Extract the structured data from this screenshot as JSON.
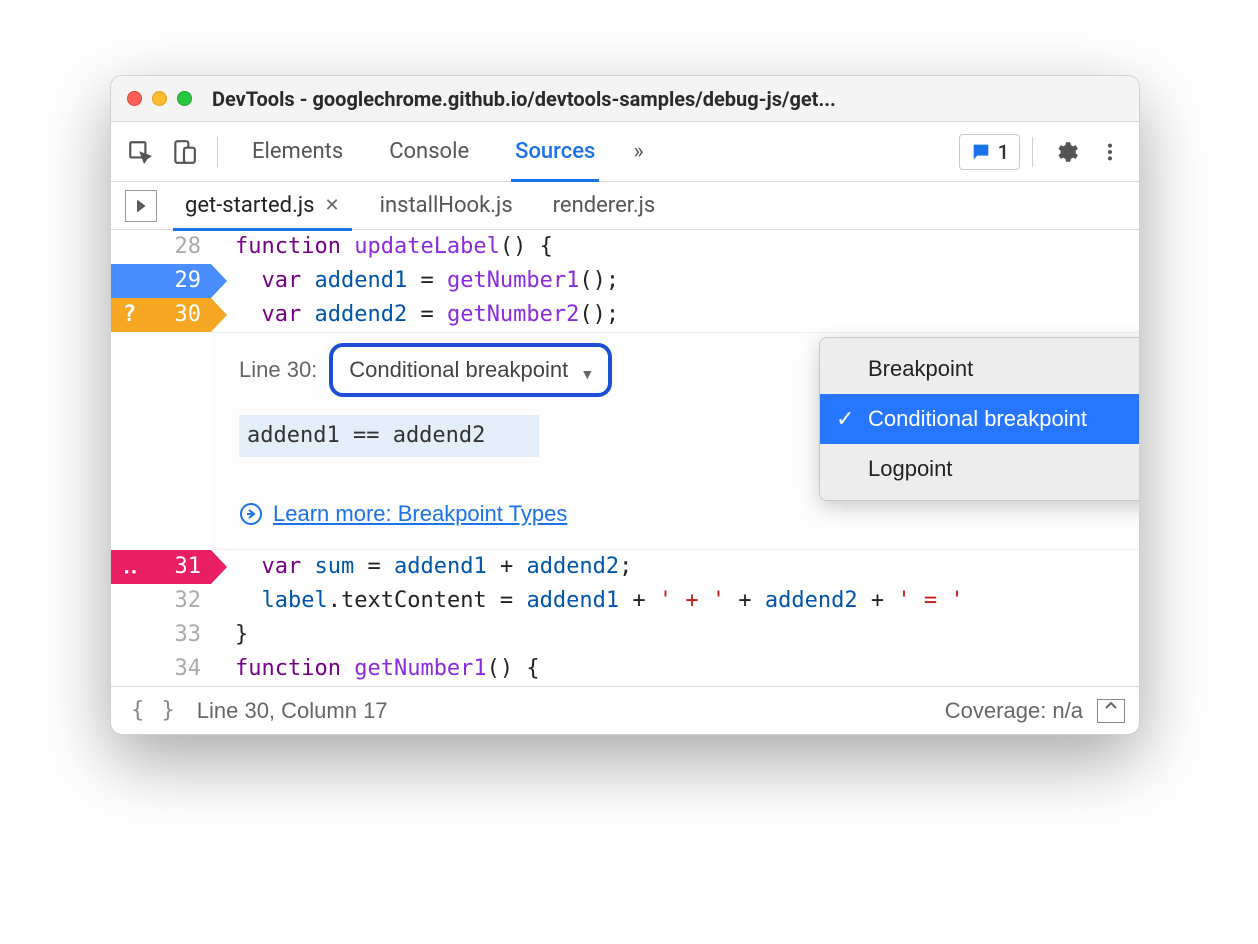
{
  "window": {
    "title": "DevTools - googlechrome.github.io/devtools-samples/debug-js/get..."
  },
  "toolbar": {
    "tabs": [
      "Elements",
      "Console",
      "Sources"
    ],
    "active_tab": "Sources",
    "overflow_glyph": "»",
    "messages_count": "1"
  },
  "file_tabs": {
    "items": [
      {
        "name": "get-started.js",
        "active": true
      },
      {
        "name": "installHook.js",
        "active": false
      },
      {
        "name": "renderer.js",
        "active": false
      }
    ]
  },
  "code": {
    "lines": [
      {
        "num": "28",
        "bp": null,
        "tokens": [
          [
            "kw",
            "function "
          ],
          [
            "fn",
            "updateLabel"
          ],
          [
            "pn",
            "() {"
          ]
        ]
      },
      {
        "num": "29",
        "bp": "blue",
        "tokens": [
          [
            "pn",
            "  "
          ],
          [
            "vk",
            "var "
          ],
          [
            "id",
            "addend1"
          ],
          [
            "op",
            " = "
          ],
          [
            "fn",
            "getNumber1"
          ],
          [
            "pn",
            "();"
          ]
        ]
      },
      {
        "num": "30",
        "bp": "orange",
        "bp_sym": "?",
        "tokens": [
          [
            "pn",
            "  "
          ],
          [
            "vk",
            "var "
          ],
          [
            "id",
            "addend2"
          ],
          [
            "op",
            " = "
          ],
          [
            "fn",
            "getNumber2"
          ],
          [
            "pn",
            "();"
          ]
        ]
      },
      {
        "num": "31",
        "bp": "pink",
        "bp_sym": "‥",
        "tokens": [
          [
            "pn",
            "  "
          ],
          [
            "vk",
            "var "
          ],
          [
            "id",
            "sum"
          ],
          [
            "op",
            " = "
          ],
          [
            "id",
            "addend1"
          ],
          [
            "op",
            " + "
          ],
          [
            "id",
            "addend2"
          ],
          [
            "pn",
            ";"
          ]
        ]
      },
      {
        "num": "32",
        "bp": null,
        "tokens": [
          [
            "pn",
            "  "
          ],
          [
            "id",
            "label"
          ],
          [
            "pn",
            "."
          ],
          [
            "prop",
            "textContent"
          ],
          [
            "op",
            " = "
          ],
          [
            "id",
            "addend1"
          ],
          [
            "op",
            " + "
          ],
          [
            "st",
            "' + '"
          ],
          [
            "op",
            " + "
          ],
          [
            "id",
            "addend2"
          ],
          [
            "op",
            " + "
          ],
          [
            "st",
            "' = '"
          ]
        ]
      },
      {
        "num": "33",
        "bp": null,
        "tokens": [
          [
            "pn",
            "}"
          ]
        ]
      },
      {
        "num": "34",
        "bp": null,
        "tokens": [
          [
            "kw",
            "function "
          ],
          [
            "fn",
            "getNumber1"
          ],
          [
            "pn",
            "() {"
          ]
        ]
      }
    ]
  },
  "breakpoint_editor": {
    "line_label": "Line 30:",
    "type_label": "Conditional breakpoint",
    "condition": "addend1 == addend2",
    "learn_more": "Learn more: Breakpoint Types",
    "dropdown": {
      "options": [
        "Breakpoint",
        "Conditional breakpoint",
        "Logpoint"
      ],
      "selected": "Conditional breakpoint"
    }
  },
  "statusbar": {
    "position": "Line 30, Column 17",
    "coverage": "Coverage: n/a"
  }
}
